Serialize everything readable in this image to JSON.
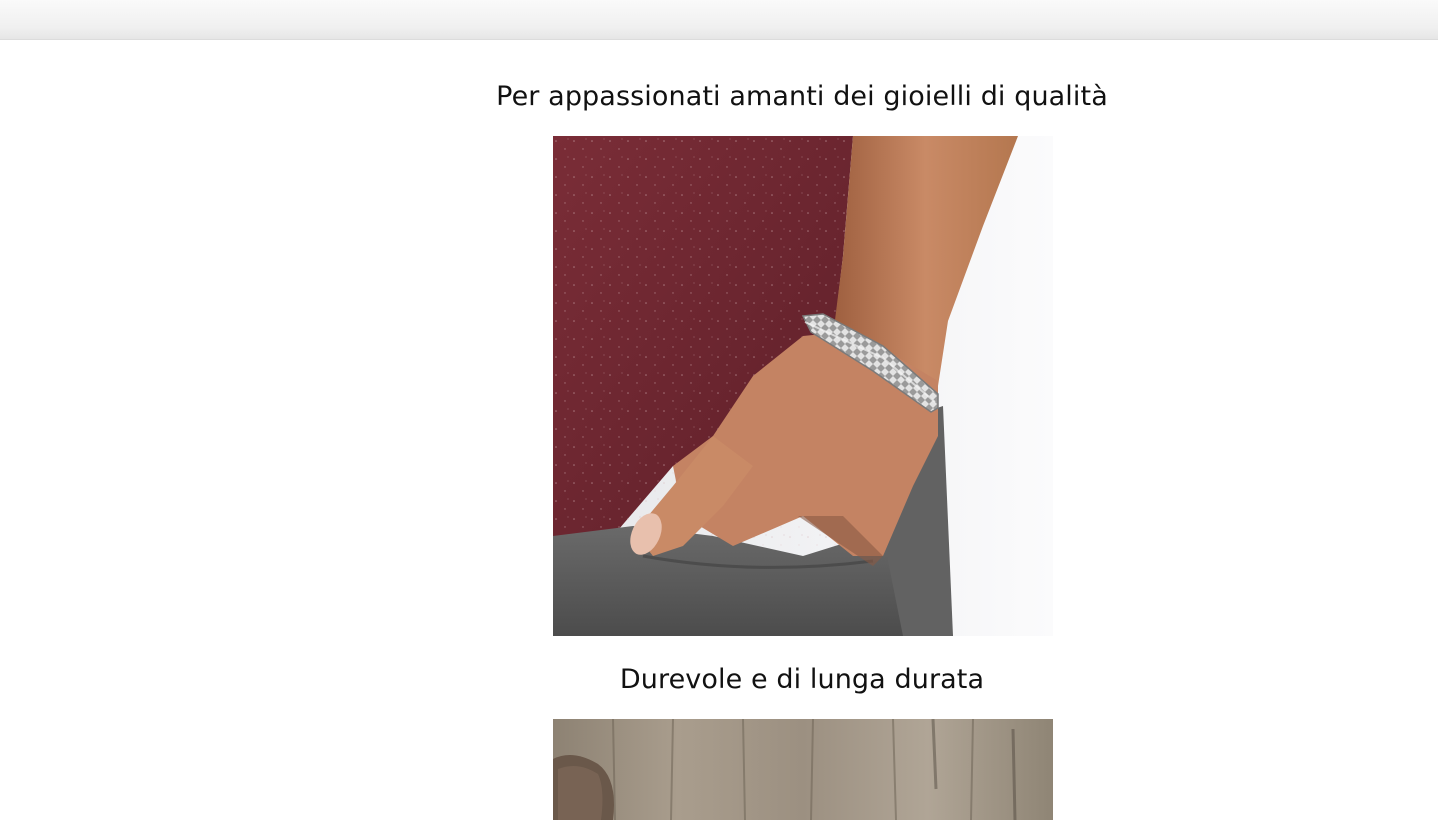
{
  "page": {
    "sections": [
      {
        "heading": "Per appassionati amanti dei gioielli di qualità",
        "image_subject": "man-wearing-silver-chain-bracelet"
      },
      {
        "heading": "Durevole e di lunga durata",
        "image_subject": "bracelet-on-wood-surface"
      }
    ]
  },
  "colors": {
    "background": "#ffffff",
    "text": "#111111",
    "shirt": "#6e2631",
    "trousers": "#5a5a5a",
    "skin": "#c98a66",
    "silver": "#c8c8c8",
    "wood": "#9a8f80"
  }
}
